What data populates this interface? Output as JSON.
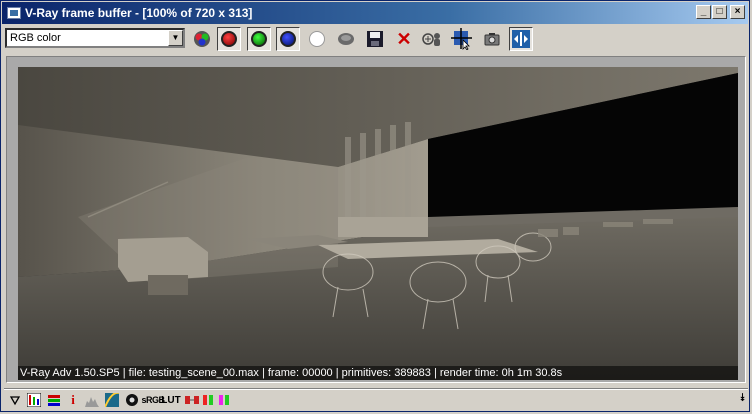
{
  "window": {
    "title": "V-Ray frame buffer - [100% of 720 x 313]"
  },
  "toolbar": {
    "channel_select": "RGB color"
  },
  "render": {
    "info": "V-Ray Adv 1.50.SP5 | file: testing_scene_00.max | frame: 00000 | primitives: 389883 | render time: 0h 1m 30.8s"
  },
  "bottom": {
    "lut_label": "LUT",
    "srgb_label": "sRGB"
  },
  "icons": [
    "app-icon",
    "minimize-icon",
    "maximize-icon",
    "close-icon",
    "rgb-channels-icon",
    "red-channel-icon",
    "green-channel-icon",
    "blue-channel-icon",
    "alpha-channel-icon",
    "mono-icon",
    "save-icon",
    "clear-icon",
    "track-mouse-icon",
    "region-render-icon",
    "render-last-icon",
    "link-to-vfb-icon",
    "expand-icon"
  ],
  "colors": {
    "title_start": "#0a246a",
    "title_end": "#a6caf0",
    "chrome": "#d4d0c8",
    "close_red": "#cc0000",
    "toggle_blue": "#1f5fa8"
  }
}
